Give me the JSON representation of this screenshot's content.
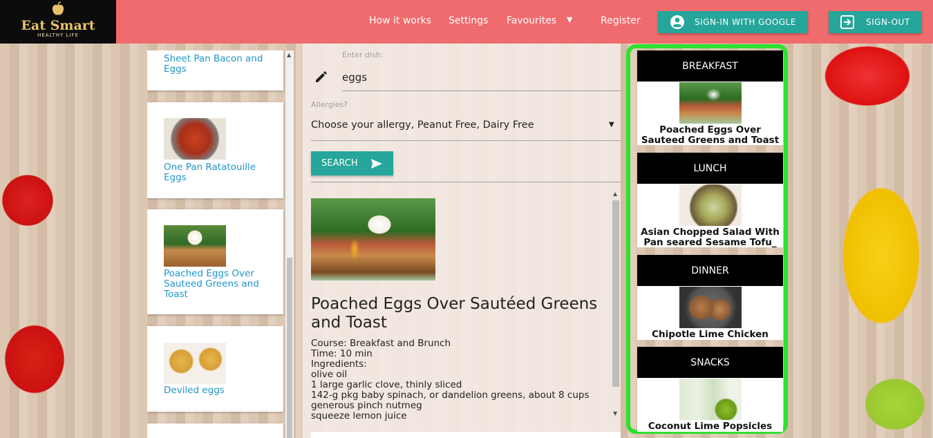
{
  "header": {
    "logo": {
      "brand": "Eat Smart",
      "tagline": "HEALTHY LIFE",
      "icon": "apple-icon"
    },
    "nav": [
      "How it works",
      "Settings",
      "Favourites",
      "Register"
    ],
    "sign_in_label": "SIGN-IN WITH GOOGLE",
    "sign_out_label": "SIGN-OUT"
  },
  "sidebar": {
    "cards": [
      {
        "title": "Sheet Pan Bacon and Eggs"
      },
      {
        "title": "One Pan Ratatouille Eggs"
      },
      {
        "title": "Poached Eggs Over Sauteed Greens and Toast"
      },
      {
        "title": "Deviled eggs"
      }
    ]
  },
  "search": {
    "dish_label": "Enter dish:",
    "dish_value": "eggs",
    "allergy_label": "Allergies?",
    "allergy_value": "Choose your allergy, Peanut Free, Dairy Free",
    "search_label": "SEARCH"
  },
  "recipe": {
    "title": "Poached Eggs Over Sautéed Greens and Toast",
    "lines": [
      "Course: Breakfast and Brunch",
      "Time: 10 min",
      "Ingredients:",
      "olive oil",
      "1 large garlic clove, thinly sliced",
      "142-g pkg baby spinach, or dandelion greens, about 8 cups",
      "generous pinch nutmeg",
      "squeeze lemon juice"
    ]
  },
  "meal_plan": [
    {
      "label": "BREAKFAST",
      "dish": "Poached Eggs Over Sauteed Greens and Toast"
    },
    {
      "label": "LUNCH",
      "dish": "Asian Chopped Salad With Pan seared Sesame Tofu_"
    },
    {
      "label": "DINNER",
      "dish": "Chipotle Lime Chicken"
    },
    {
      "label": "SNACKS",
      "dish": "Coconut Lime Popsicles"
    }
  ],
  "colors": {
    "header": "#f06b6d",
    "accent": "#26a69a",
    "link": "#2196c8",
    "highlight": "#2ee12e"
  }
}
